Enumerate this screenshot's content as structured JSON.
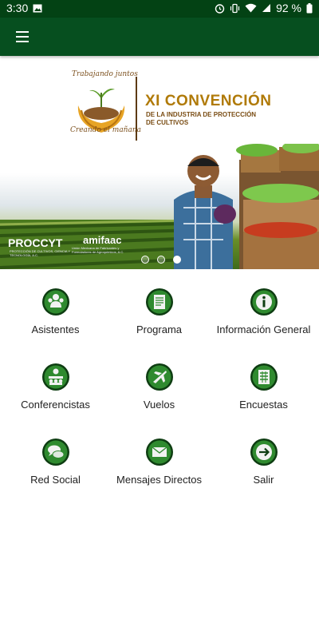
{
  "status_bar": {
    "time": "3:30",
    "battery": "92 %"
  },
  "app_bar": {
    "menu_icon": "hamburger-menu-icon"
  },
  "banner": {
    "logo_caption_top": "Trabajando juntos",
    "logo_caption_bottom": "Creando el mañana",
    "title": "XI CONVENCIÓN",
    "subtitle_line1": "DE LA INDUSTRIA DE PROTECCIÓN",
    "subtitle_line2": "DE CULTIVOS",
    "sponsor1": "PROCCYT",
    "sponsor1_tagline": "PROTECCIÓN DE CULTIVOS, CIENCIA Y TECNOLOGÍA, A.C.",
    "sponsor2": "amifaac",
    "sponsor2_tagline": "Unión Mexicana de Fabricantes y Formuladores de Agroquímicos, A.C.",
    "slides": 3,
    "active_slide": 3
  },
  "menu": [
    {
      "label": "Asistentes",
      "icon": "attendees-icon"
    },
    {
      "label": "Programa",
      "icon": "program-scroll-icon"
    },
    {
      "label": "Información General",
      "icon": "info-icon"
    },
    {
      "label": "Conferencistas",
      "icon": "speakers-icon"
    },
    {
      "label": "Vuelos",
      "icon": "airplane-icon"
    },
    {
      "label": "Encuestas",
      "icon": "survey-icon"
    },
    {
      "label": "Red Social",
      "icon": "chat-bubbles-icon"
    },
    {
      "label": "Mensajes Directos",
      "icon": "envelope-icon"
    },
    {
      "label": "Salir",
      "icon": "exit-arrow-icon"
    }
  ],
  "colors": {
    "primary": "#064f1f",
    "status_bar": "#034214",
    "icon_green": "#2f8a2f",
    "icon_dark": "#0e3d12"
  }
}
